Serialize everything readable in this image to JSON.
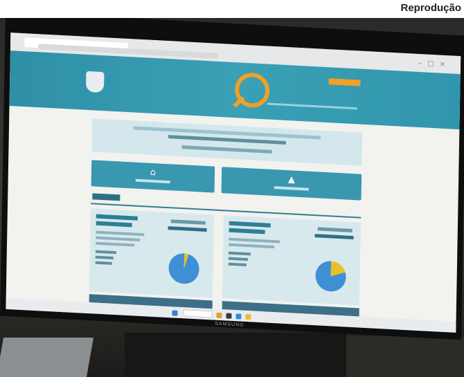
{
  "credit": "Reprodução",
  "monitor_brand": "SAMSUNG",
  "colors": {
    "banner": "#3aa0b5",
    "accent_orange": "#f0a125",
    "button": "#3a97b0",
    "card": "#d8e9ee",
    "pie_blue": "#3f8fd4",
    "pie_yellow": "#e8c02a"
  },
  "browser": {
    "icons": [
      "minimize-icon",
      "maximize-icon",
      "close-icon"
    ]
  },
  "site": {
    "left_logo": "crest-icon",
    "portal_logo": "magnifier-icon"
  },
  "cards": [
    {
      "pie_share_yellow": 0.05
    },
    {
      "pie_share_yellow": 0.2
    }
  ]
}
